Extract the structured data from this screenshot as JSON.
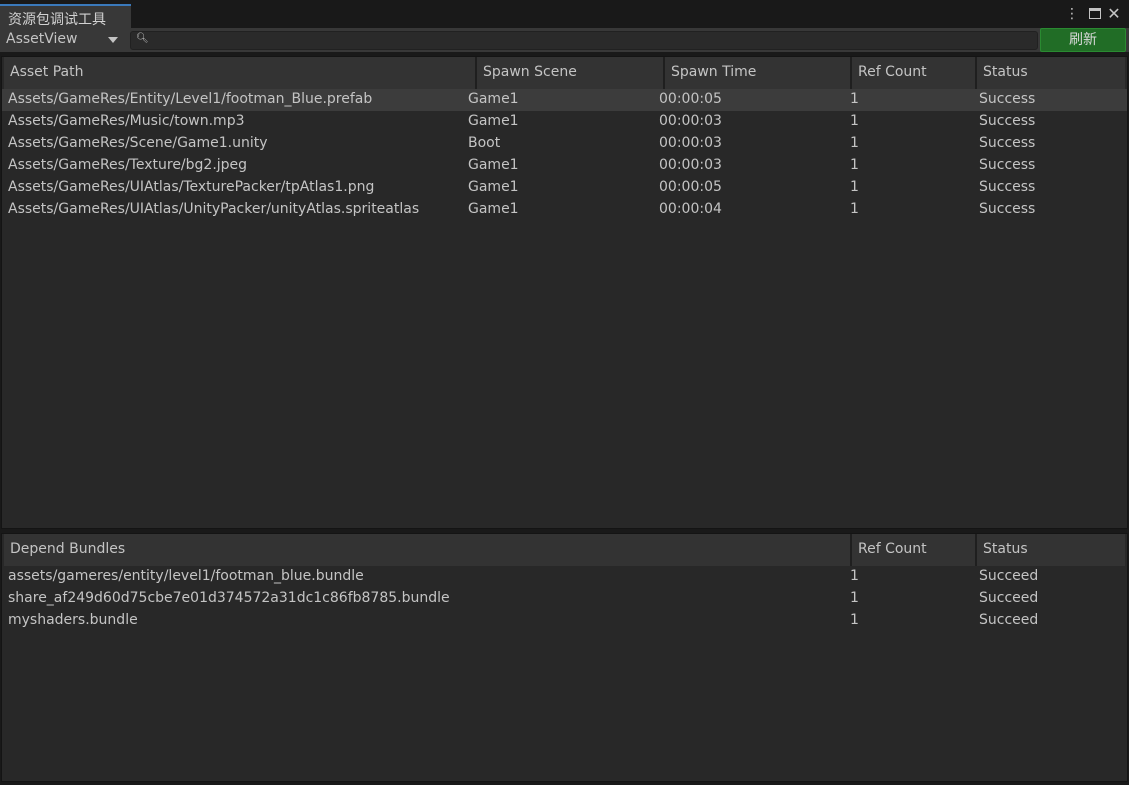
{
  "window": {
    "tab_title": "资源包调试工具",
    "more_icon": "⋮",
    "close_icon": "✕"
  },
  "toolbar": {
    "view_selected": "AssetView",
    "search_value": "",
    "refresh_label": "刷新"
  },
  "asset_table": {
    "columns": [
      "Asset Path",
      "Spawn Scene",
      "Spawn Time",
      "Ref Count",
      "Status"
    ],
    "rows": [
      [
        "Assets/GameRes/Entity/Level1/footman_Blue.prefab",
        "Game1",
        "00:00:05",
        "1",
        "Success"
      ],
      [
        "Assets/GameRes/Music/town.mp3",
        "Game1",
        "00:00:03",
        "1",
        "Success"
      ],
      [
        "Assets/GameRes/Scene/Game1.unity",
        "Boot",
        "00:00:03",
        "1",
        "Success"
      ],
      [
        "Assets/GameRes/Texture/bg2.jpeg",
        "Game1",
        "00:00:03",
        "1",
        "Success"
      ],
      [
        "Assets/GameRes/UIAtlas/TexturePacker/tpAtlas1.png",
        "Game1",
        "00:00:05",
        "1",
        "Success"
      ],
      [
        "Assets/GameRes/UIAtlas/UnityPacker/unityAtlas.spriteatlas",
        "Game1",
        "00:00:04",
        "1",
        "Success"
      ]
    ]
  },
  "bundle_table": {
    "columns": [
      "Depend Bundles",
      "Ref Count",
      "Status"
    ],
    "rows": [
      [
        "assets/gameres/entity/level1/footman_blue.bundle",
        "1",
        "Succeed"
      ],
      [
        "share_af249d60d75cbe7e01d374572a31dc1c86fb8785.bundle",
        "1",
        "Succeed"
      ],
      [
        "myshaders.bundle",
        "1",
        "Succeed"
      ]
    ]
  },
  "colors": {
    "accent": "#3a79bb",
    "refresh_button": "#216d26",
    "panel_bg": "#282828",
    "selected_row": "#3c3c3c"
  }
}
